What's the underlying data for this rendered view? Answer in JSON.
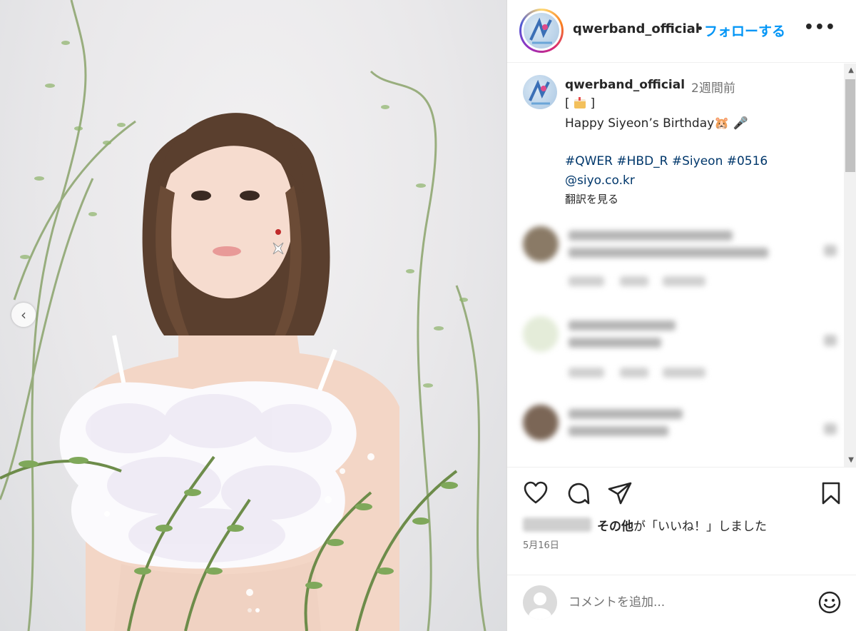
{
  "post": {
    "username": "qwerband_official",
    "follow_label": "フォローする",
    "more_label": "•••"
  },
  "caption": {
    "username": "qwerband_official",
    "time_ago": "2週間前",
    "line1_prefix": "[",
    "line1_suffix": "]",
    "line2": "Happy Siyeon’s Birthday🐹 🎤",
    "hashtags": "#QWER #HBD_R #Siyeon #0516",
    "mention": "@siyo.co.kr",
    "translate_label": "翻訳を見る"
  },
  "likes": {
    "bold": "その他",
    "rest": "が「いいね！」しました"
  },
  "date": "5月16日",
  "comment_input": {
    "placeholder": "コメントを追加..."
  },
  "icons": [
    "like-icon",
    "comment-icon",
    "share-icon",
    "save-icon",
    "emoji-icon",
    "carousel-prev-icon",
    "more-icon"
  ],
  "colors": {
    "accent": "#0095f6",
    "link": "#00376b",
    "text": "#262626",
    "muted": "#737373"
  }
}
